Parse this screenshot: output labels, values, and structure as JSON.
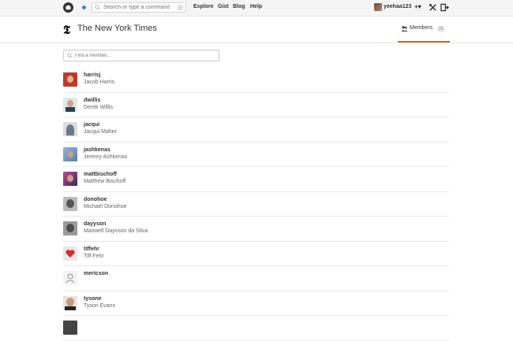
{
  "topbar": {
    "search_placeholder": "Search or type a command",
    "nav": [
      "Explore",
      "Gist",
      "Blog",
      "Help"
    ],
    "username": "yeehaa123",
    "plus": "+▾"
  },
  "org": {
    "name": "The New York Times",
    "logo_glyph": "𝕿",
    "members_tab": "Members",
    "members_count": "21"
  },
  "filter": {
    "placeholder": "Find a member..."
  },
  "members": [
    {
      "login": "harrisj",
      "name": "Jacob Harris",
      "avatar_color": "#c0392b"
    },
    {
      "login": "dwillis",
      "name": "Derek Willis",
      "avatar_color": "#dfe8ee"
    },
    {
      "login": "jacqui",
      "name": "Jacqui Maher",
      "avatar_color": "#6c7a8a"
    },
    {
      "login": "jashkenas",
      "name": "Jeremy Ashkenas",
      "avatar_color": "#5d7fa6"
    },
    {
      "login": "mattbischoff",
      "name": "Matthew Bischoff",
      "avatar_color": "#7a3b6b"
    },
    {
      "login": "donohoe",
      "name": "Michael Donohoe",
      "avatar_color": "#555555"
    },
    {
      "login": "dayyson",
      "name": "Maxwell Dayvson da Silva",
      "avatar_color": "#6d6d6d"
    },
    {
      "login": "tiffehr",
      "name": "Tiff Fehr",
      "avatar_color": "#e8e8e8"
    },
    {
      "login": "mericson",
      "name": "",
      "avatar_color": "#f3f3f3"
    },
    {
      "login": "tysone",
      "name": "Tyson Evans",
      "avatar_color": "#8a7a6a"
    },
    {
      "login": "",
      "name": "",
      "avatar_color": "#444444"
    }
  ]
}
